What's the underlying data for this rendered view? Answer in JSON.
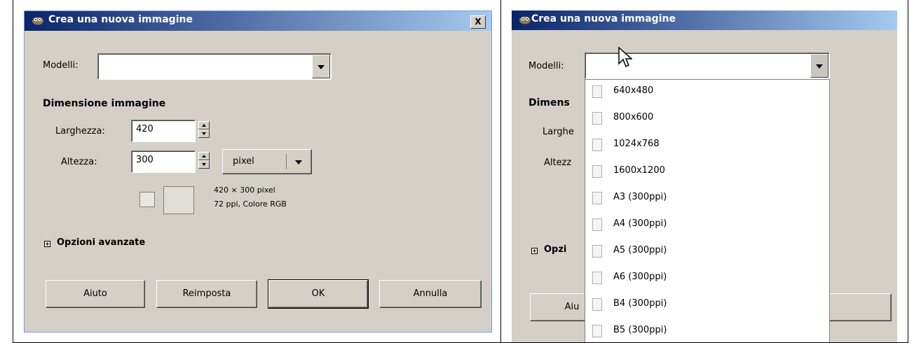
{
  "left_dialog": {
    "title": "Crea una nuova immagine",
    "close_label": "X",
    "models_label": "Modelli:",
    "models_value": "",
    "section_title": "Dimensione immagine",
    "width_label": "Larghezza:",
    "width_value": "420",
    "height_label": "Altezza:",
    "height_value": "300",
    "unit_value": "pixel",
    "info_line1": "420 × 300 pixel",
    "info_line2": "72 ppi, Colore RGB",
    "advanced_label": "Opzioni avanzate",
    "buttons": {
      "help": "Aiuto",
      "reset": "Reimposta",
      "ok": "OK",
      "cancel": "Annulla"
    }
  },
  "right_dialog": {
    "title": "Crea una nuova immagine",
    "models_label": "Modelli:",
    "section_title_partial": "Dimens",
    "width_label_partial": "Larghe",
    "height_label_partial": "Altezz",
    "advanced_partial": "Opzi",
    "help_partial": "Aiu",
    "templates": [
      "640x480",
      "800x600",
      "1024x768",
      "1600x1200",
      "A3 (300ppi)",
      "A4 (300ppi)",
      "A5 (300ppi)",
      "A6 (300ppi)",
      "B4 (300ppi)",
      "B5 (300ppi)"
    ]
  },
  "colors": {
    "dialog_bg": "#d4d0c8",
    "title_start": "#0a246a",
    "title_end": "#a6caf0"
  }
}
